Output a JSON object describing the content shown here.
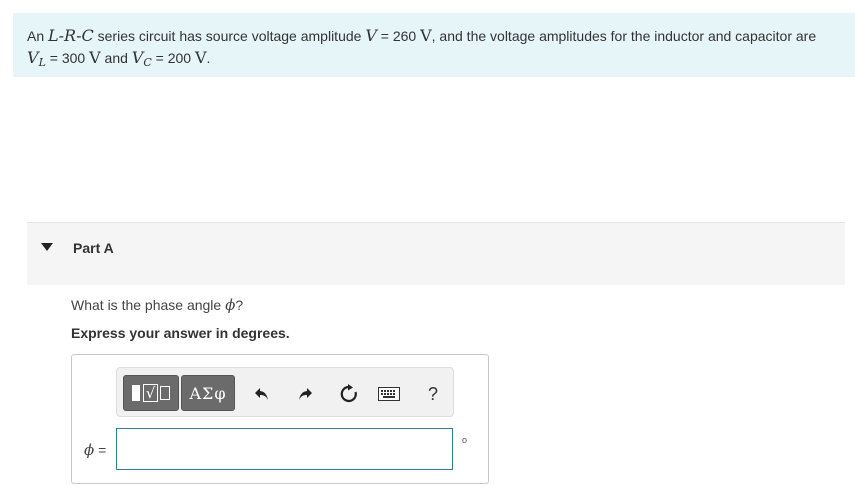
{
  "problem": {
    "t1": "An ",
    "circuit": "L-R-C",
    "t2": " series circuit has source voltage amplitude ",
    "V": "V",
    "t3": " = 260 ",
    "unitV": "V",
    "t4": ", and the voltage amplitudes for the inductor and capacitor are",
    "VL_base": "V",
    "VL_sub": "L",
    "t5": " = 300 ",
    "unitV2": "V",
    "t6": " and ",
    "VC_base": "V",
    "VC_sub": "C",
    "t7": " = 200 ",
    "unitV3": "V",
    "t8": "."
  },
  "part": {
    "title": "Part A"
  },
  "question": {
    "text_before": "What is the phase angle ",
    "symbol": "ϕ",
    "text_after": "?",
    "instruction": "Express your answer in degrees."
  },
  "toolbar": {
    "templates_symbol": "√",
    "symbols_label": "ΑΣφ",
    "undo_icon": "undo-icon",
    "redo_icon": "redo-icon",
    "reset_icon": "reset-icon",
    "keyboard_icon": "keyboard-icon",
    "help_label": "?"
  },
  "answer": {
    "label_symbol": "ϕ",
    "label_eq": " =",
    "value": "",
    "unit": "o"
  },
  "colors": {
    "problem_bg": "#e6f5f7",
    "input_border": "#2d7e9a",
    "button_dark": "#6b6b6b"
  }
}
